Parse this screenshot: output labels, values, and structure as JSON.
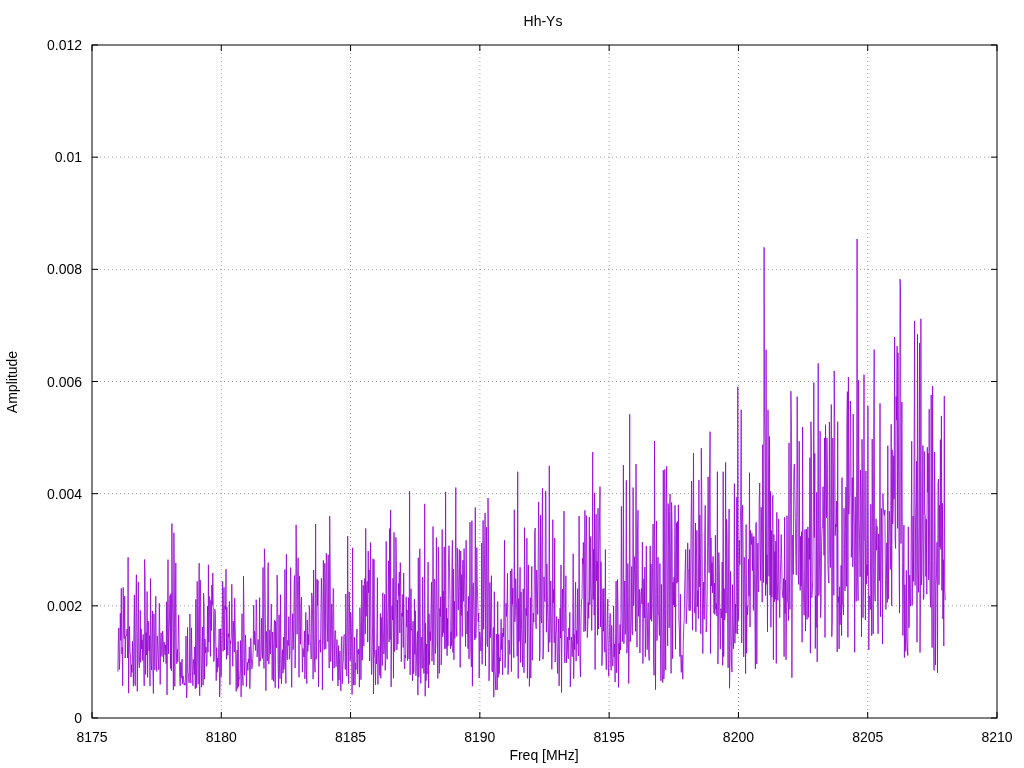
{
  "plot": {
    "title": "Hh-Ys",
    "xlabel": "Freq [MHz]",
    "ylabel": "Amplitude",
    "xticks": [
      "8175",
      "8180",
      "8185",
      "8190",
      "8195",
      "8200",
      "8205",
      "8210"
    ],
    "yticks": [
      "0.012",
      "0.01",
      "0.008",
      "0.006",
      "0.004",
      "0.002",
      "0"
    ]
  }
}
